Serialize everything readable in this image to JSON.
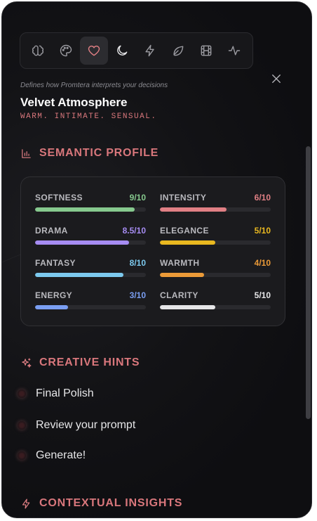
{
  "toolbar": {
    "icons": [
      "brain-icon",
      "palette-icon",
      "heart-icon",
      "moon-icon",
      "bolt-icon",
      "leaf-icon",
      "film-icon",
      "pulse-icon"
    ],
    "active": "heart-icon"
  },
  "header": {
    "subtitle": "Defines how Promtera interprets your decisions",
    "title": "Velvet Atmosphere",
    "tagline": "WARM. INTIMATE. SENSUAL."
  },
  "semantic_profile": {
    "heading": "SEMANTIC PROFILE",
    "metrics": [
      {
        "name": "SOFTNESS",
        "score": "9/10",
        "value": 9,
        "color": "#86c98e"
      },
      {
        "name": "INTENSITY",
        "score": "6/10",
        "value": 6,
        "color": "#e07f84"
      },
      {
        "name": "DRAMA",
        "score": "8.5/10",
        "value": 8.5,
        "color": "#a68cf2"
      },
      {
        "name": "ELEGANCE",
        "score": "5/10",
        "value": 5,
        "color": "#e9b820"
      },
      {
        "name": "FANTASY",
        "score": "8/10",
        "value": 8,
        "color": "#7cc9ee"
      },
      {
        "name": "WARMTH",
        "score": "4/10",
        "value": 4,
        "color": "#eb9a38"
      },
      {
        "name": "ENERGY",
        "score": "3/10",
        "value": 3,
        "color": "#7a9ef2"
      },
      {
        "name": "CLARITY",
        "score": "5/10",
        "value": 5,
        "color": "#e6e6e8"
      }
    ]
  },
  "creative_hints": {
    "heading": "CREATIVE HINTS",
    "items": [
      "Final Polish",
      "Review your prompt",
      "Generate!"
    ]
  },
  "contextual_insights": {
    "heading": "CONTEXTUAL INSIGHTS"
  },
  "colors": {
    "accent": "#e07f84",
    "panel": "#131316"
  }
}
